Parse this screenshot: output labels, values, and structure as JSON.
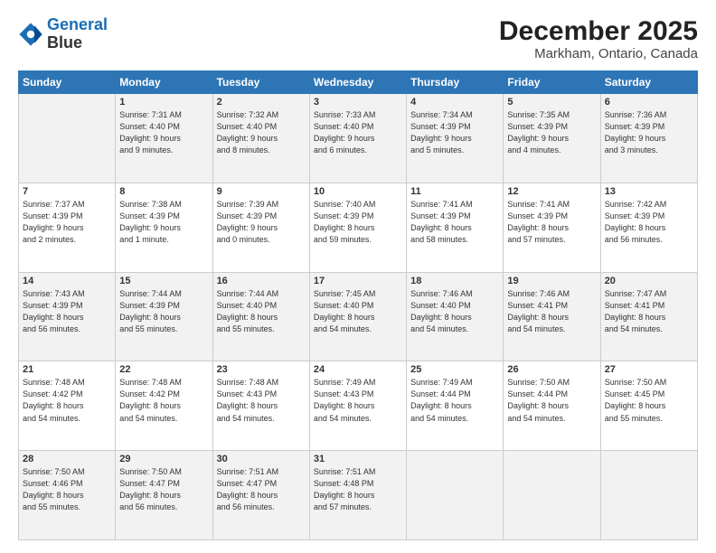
{
  "header": {
    "logo_line1": "General",
    "logo_line2": "Blue",
    "title": "December 2025",
    "subtitle": "Markham, Ontario, Canada"
  },
  "weekdays": [
    "Sunday",
    "Monday",
    "Tuesday",
    "Wednesday",
    "Thursday",
    "Friday",
    "Saturday"
  ],
  "weeks": [
    [
      {
        "day": "",
        "info": ""
      },
      {
        "day": "1",
        "info": "Sunrise: 7:31 AM\nSunset: 4:40 PM\nDaylight: 9 hours\nand 9 minutes."
      },
      {
        "day": "2",
        "info": "Sunrise: 7:32 AM\nSunset: 4:40 PM\nDaylight: 9 hours\nand 8 minutes."
      },
      {
        "day": "3",
        "info": "Sunrise: 7:33 AM\nSunset: 4:40 PM\nDaylight: 9 hours\nand 6 minutes."
      },
      {
        "day": "4",
        "info": "Sunrise: 7:34 AM\nSunset: 4:39 PM\nDaylight: 9 hours\nand 5 minutes."
      },
      {
        "day": "5",
        "info": "Sunrise: 7:35 AM\nSunset: 4:39 PM\nDaylight: 9 hours\nand 4 minutes."
      },
      {
        "day": "6",
        "info": "Sunrise: 7:36 AM\nSunset: 4:39 PM\nDaylight: 9 hours\nand 3 minutes."
      }
    ],
    [
      {
        "day": "7",
        "info": "Sunrise: 7:37 AM\nSunset: 4:39 PM\nDaylight: 9 hours\nand 2 minutes."
      },
      {
        "day": "8",
        "info": "Sunrise: 7:38 AM\nSunset: 4:39 PM\nDaylight: 9 hours\nand 1 minute."
      },
      {
        "day": "9",
        "info": "Sunrise: 7:39 AM\nSunset: 4:39 PM\nDaylight: 9 hours\nand 0 minutes."
      },
      {
        "day": "10",
        "info": "Sunrise: 7:40 AM\nSunset: 4:39 PM\nDaylight: 8 hours\nand 59 minutes."
      },
      {
        "day": "11",
        "info": "Sunrise: 7:41 AM\nSunset: 4:39 PM\nDaylight: 8 hours\nand 58 minutes."
      },
      {
        "day": "12",
        "info": "Sunrise: 7:41 AM\nSunset: 4:39 PM\nDaylight: 8 hours\nand 57 minutes."
      },
      {
        "day": "13",
        "info": "Sunrise: 7:42 AM\nSunset: 4:39 PM\nDaylight: 8 hours\nand 56 minutes."
      }
    ],
    [
      {
        "day": "14",
        "info": "Sunrise: 7:43 AM\nSunset: 4:39 PM\nDaylight: 8 hours\nand 56 minutes."
      },
      {
        "day": "15",
        "info": "Sunrise: 7:44 AM\nSunset: 4:39 PM\nDaylight: 8 hours\nand 55 minutes."
      },
      {
        "day": "16",
        "info": "Sunrise: 7:44 AM\nSunset: 4:40 PM\nDaylight: 8 hours\nand 55 minutes."
      },
      {
        "day": "17",
        "info": "Sunrise: 7:45 AM\nSunset: 4:40 PM\nDaylight: 8 hours\nand 54 minutes."
      },
      {
        "day": "18",
        "info": "Sunrise: 7:46 AM\nSunset: 4:40 PM\nDaylight: 8 hours\nand 54 minutes."
      },
      {
        "day": "19",
        "info": "Sunrise: 7:46 AM\nSunset: 4:41 PM\nDaylight: 8 hours\nand 54 minutes."
      },
      {
        "day": "20",
        "info": "Sunrise: 7:47 AM\nSunset: 4:41 PM\nDaylight: 8 hours\nand 54 minutes."
      }
    ],
    [
      {
        "day": "21",
        "info": "Sunrise: 7:48 AM\nSunset: 4:42 PM\nDaylight: 8 hours\nand 54 minutes."
      },
      {
        "day": "22",
        "info": "Sunrise: 7:48 AM\nSunset: 4:42 PM\nDaylight: 8 hours\nand 54 minutes."
      },
      {
        "day": "23",
        "info": "Sunrise: 7:48 AM\nSunset: 4:43 PM\nDaylight: 8 hours\nand 54 minutes."
      },
      {
        "day": "24",
        "info": "Sunrise: 7:49 AM\nSunset: 4:43 PM\nDaylight: 8 hours\nand 54 minutes."
      },
      {
        "day": "25",
        "info": "Sunrise: 7:49 AM\nSunset: 4:44 PM\nDaylight: 8 hours\nand 54 minutes."
      },
      {
        "day": "26",
        "info": "Sunrise: 7:50 AM\nSunset: 4:44 PM\nDaylight: 8 hours\nand 54 minutes."
      },
      {
        "day": "27",
        "info": "Sunrise: 7:50 AM\nSunset: 4:45 PM\nDaylight: 8 hours\nand 55 minutes."
      }
    ],
    [
      {
        "day": "28",
        "info": "Sunrise: 7:50 AM\nSunset: 4:46 PM\nDaylight: 8 hours\nand 55 minutes."
      },
      {
        "day": "29",
        "info": "Sunrise: 7:50 AM\nSunset: 4:47 PM\nDaylight: 8 hours\nand 56 minutes."
      },
      {
        "day": "30",
        "info": "Sunrise: 7:51 AM\nSunset: 4:47 PM\nDaylight: 8 hours\nand 56 minutes."
      },
      {
        "day": "31",
        "info": "Sunrise: 7:51 AM\nSunset: 4:48 PM\nDaylight: 8 hours\nand 57 minutes."
      },
      {
        "day": "",
        "info": ""
      },
      {
        "day": "",
        "info": ""
      },
      {
        "day": "",
        "info": ""
      }
    ]
  ]
}
